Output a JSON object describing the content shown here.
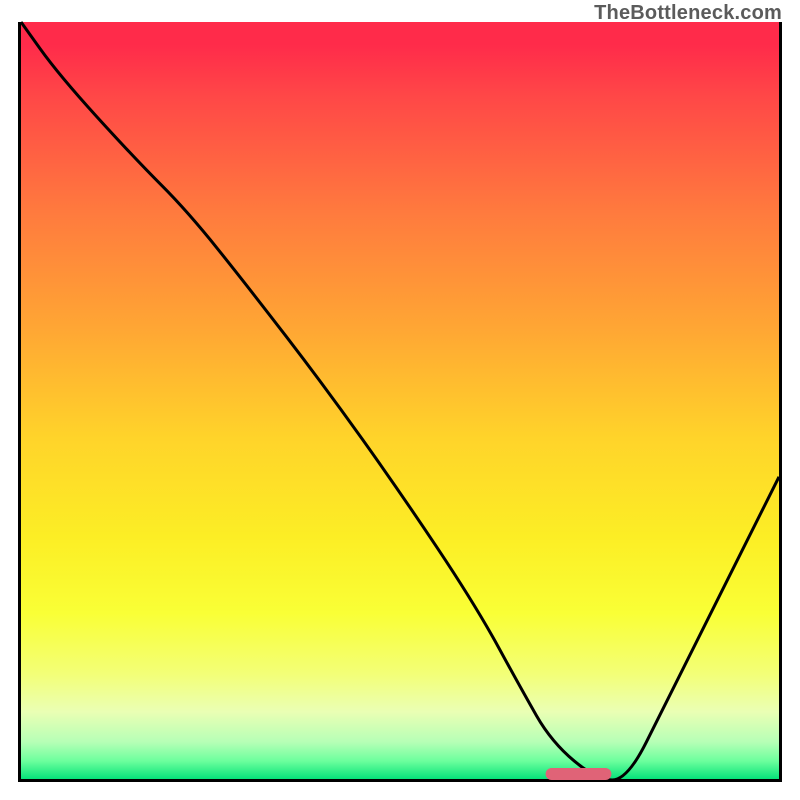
{
  "watermark": "TheBottleneck.com",
  "chart_data": {
    "type": "line",
    "title": "",
    "xlabel": "",
    "ylabel": "",
    "xlim": [
      0,
      100
    ],
    "ylim": [
      0,
      100
    ],
    "series": [
      {
        "name": "bottleneck-curve",
        "x": [
          0,
          5,
          15,
          22,
          30,
          40,
          50,
          60,
          66,
          70,
          76,
          80,
          85,
          90,
          100
        ],
        "values": [
          100,
          93,
          82,
          75,
          65,
          52,
          38,
          23,
          12,
          5,
          0,
          0,
          10,
          20,
          40
        ]
      }
    ],
    "optimum": {
      "x_start": 70,
      "x_end": 80,
      "y": 0
    },
    "grid": false,
    "legend": false
  }
}
